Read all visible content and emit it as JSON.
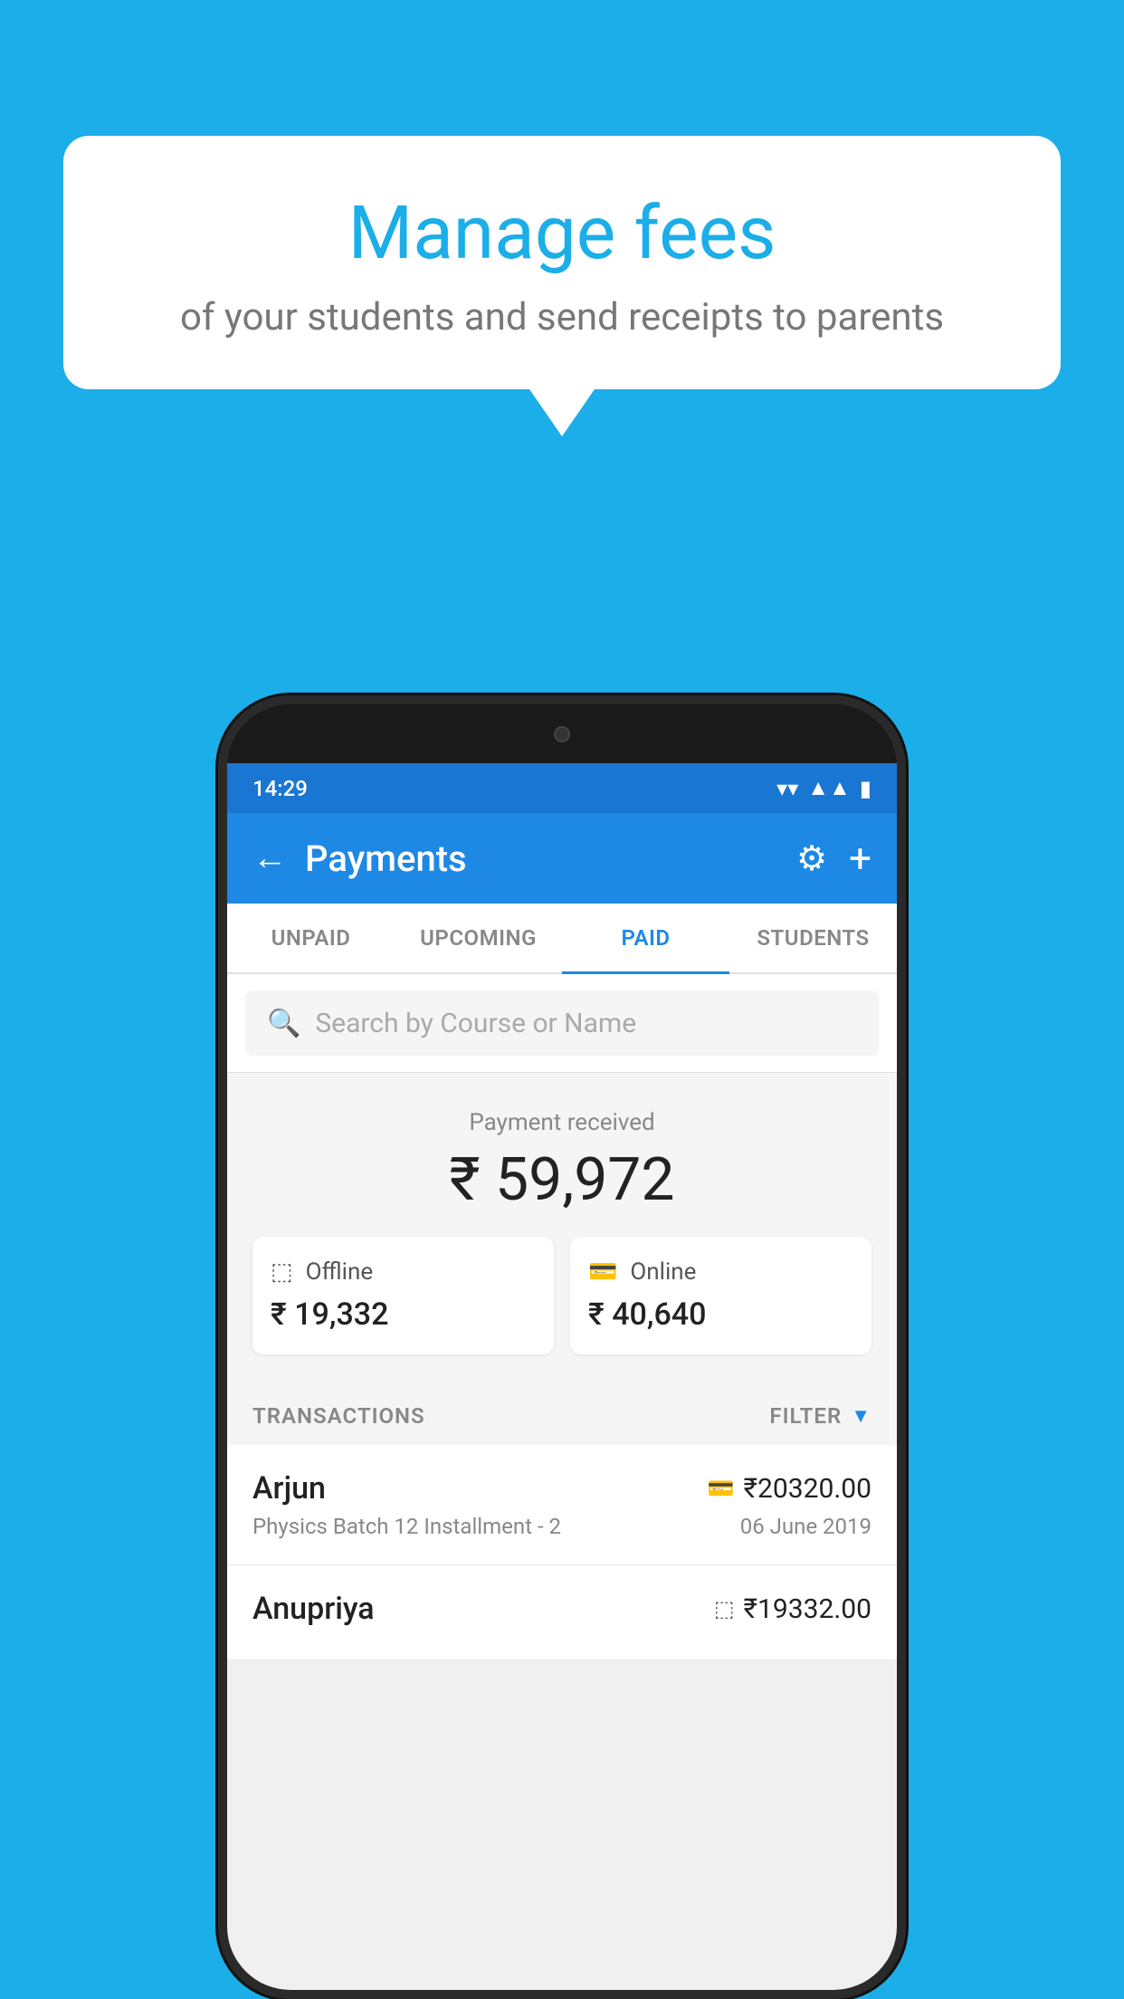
{
  "background_color": "#1BAEE8",
  "bubble": {
    "title": "Manage fees",
    "subtitle": "of your students and send receipts to parents"
  },
  "status_bar": {
    "time": "14:29"
  },
  "app_bar": {
    "title": "Payments",
    "back_label": "←",
    "gear_label": "⚙",
    "plus_label": "+"
  },
  "tabs": [
    {
      "label": "UNPAID",
      "active": false
    },
    {
      "label": "UPCOMING",
      "active": false
    },
    {
      "label": "PAID",
      "active": true
    },
    {
      "label": "STUDENTS",
      "active": false
    }
  ],
  "search": {
    "placeholder": "Search by Course or Name"
  },
  "payment_summary": {
    "received_label": "Payment received",
    "total_amount": "₹ 59,972",
    "offline_label": "Offline",
    "offline_amount": "₹ 19,332",
    "online_label": "Online",
    "online_amount": "₹ 40,640"
  },
  "transactions": {
    "section_label": "TRANSACTIONS",
    "filter_label": "FILTER",
    "rows": [
      {
        "name": "Arjun",
        "course": "Physics Batch 12 Installment - 2",
        "date": "06 June 2019",
        "amount": "₹20320.00",
        "payment_type": "card"
      },
      {
        "name": "Anupriya",
        "course": "",
        "date": "",
        "amount": "₹19332.00",
        "payment_type": "offline"
      }
    ]
  }
}
